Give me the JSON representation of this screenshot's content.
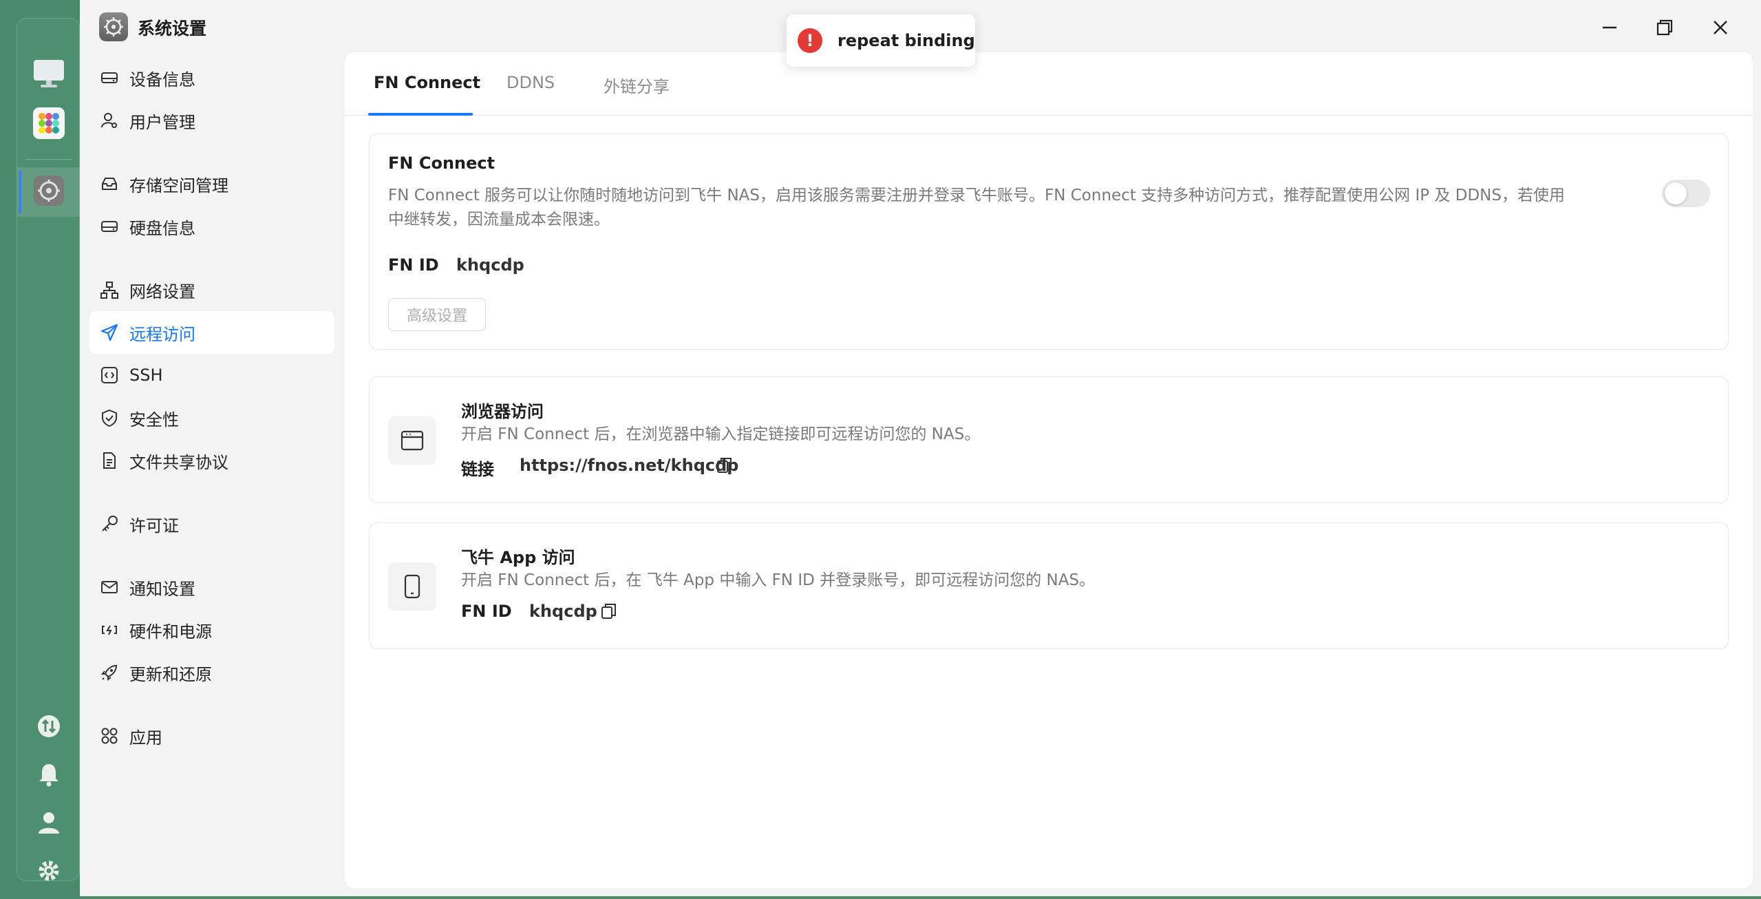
{
  "window": {
    "title": "系统设置"
  },
  "toast": {
    "message": "repeat binding",
    "color": "#e53935"
  },
  "dock": {
    "items": [
      {
        "name": "desktop-icon"
      },
      {
        "name": "app-center-icon"
      },
      {
        "name": "settings-icon",
        "active": true
      }
    ],
    "bottom": [
      {
        "name": "transfer-icon"
      },
      {
        "name": "bell-icon"
      },
      {
        "name": "user-icon"
      },
      {
        "name": "gear-icon"
      }
    ]
  },
  "sidebar": {
    "items": [
      {
        "label": "设备信息",
        "icon": "device-icon"
      },
      {
        "label": "用户管理",
        "icon": "user-manage-icon"
      },
      {
        "label": "存储空间管理",
        "icon": "storage-icon"
      },
      {
        "label": "硬盘信息",
        "icon": "disk-icon"
      },
      {
        "label": "网络设置",
        "icon": "network-icon"
      },
      {
        "label": "远程访问",
        "icon": "send-icon",
        "active": true
      },
      {
        "label": "SSH",
        "icon": "code-icon"
      },
      {
        "label": "安全性",
        "icon": "shield-icon"
      },
      {
        "label": "文件共享协议",
        "icon": "file-icon"
      },
      {
        "label": "许可证",
        "icon": "key-icon"
      },
      {
        "label": "通知设置",
        "icon": "mail-icon"
      },
      {
        "label": "硬件和电源",
        "icon": "battery-icon"
      },
      {
        "label": "更新和还原",
        "icon": "rocket-icon"
      },
      {
        "label": "应用",
        "icon": "apps-icon"
      }
    ]
  },
  "tabs": [
    {
      "label": "FN Connect",
      "active": true
    },
    {
      "label": "DDNS"
    },
    {
      "label": "外链分享"
    }
  ],
  "fn_connect": {
    "title": "FN Connect",
    "desc_line1": "FN Connect 服务可以让你随时随地访问到飞牛 NAS，启用该服务需要注册并登录飞牛账号。FN Connect 支持多种访问方式，推荐配置使用公网 IP 及 DDNS，若使用",
    "desc_line2": "中继转发，因流量成本会限速。",
    "id_key": "FN ID",
    "id_value": "khqcdp",
    "advanced_label": "高级设置",
    "enabled": false
  },
  "browser_access": {
    "title": "浏览器访问",
    "desc": "开启 FN Connect 后，在浏览器中输入指定链接即可远程访问您的 NAS。",
    "link_key": "链接",
    "link_value": "https://fnos.net/khqcdp"
  },
  "app_access": {
    "title": "飞牛 App 访问",
    "desc": "开启 FN Connect 后，在 飞牛 App 中输入 FN ID 并登录账号，即可远程访问您的 NAS。",
    "id_key": "FN ID",
    "id_value": "khqcdp"
  },
  "colors": {
    "accent": "#1677ff",
    "dock": "#4e8f70"
  }
}
